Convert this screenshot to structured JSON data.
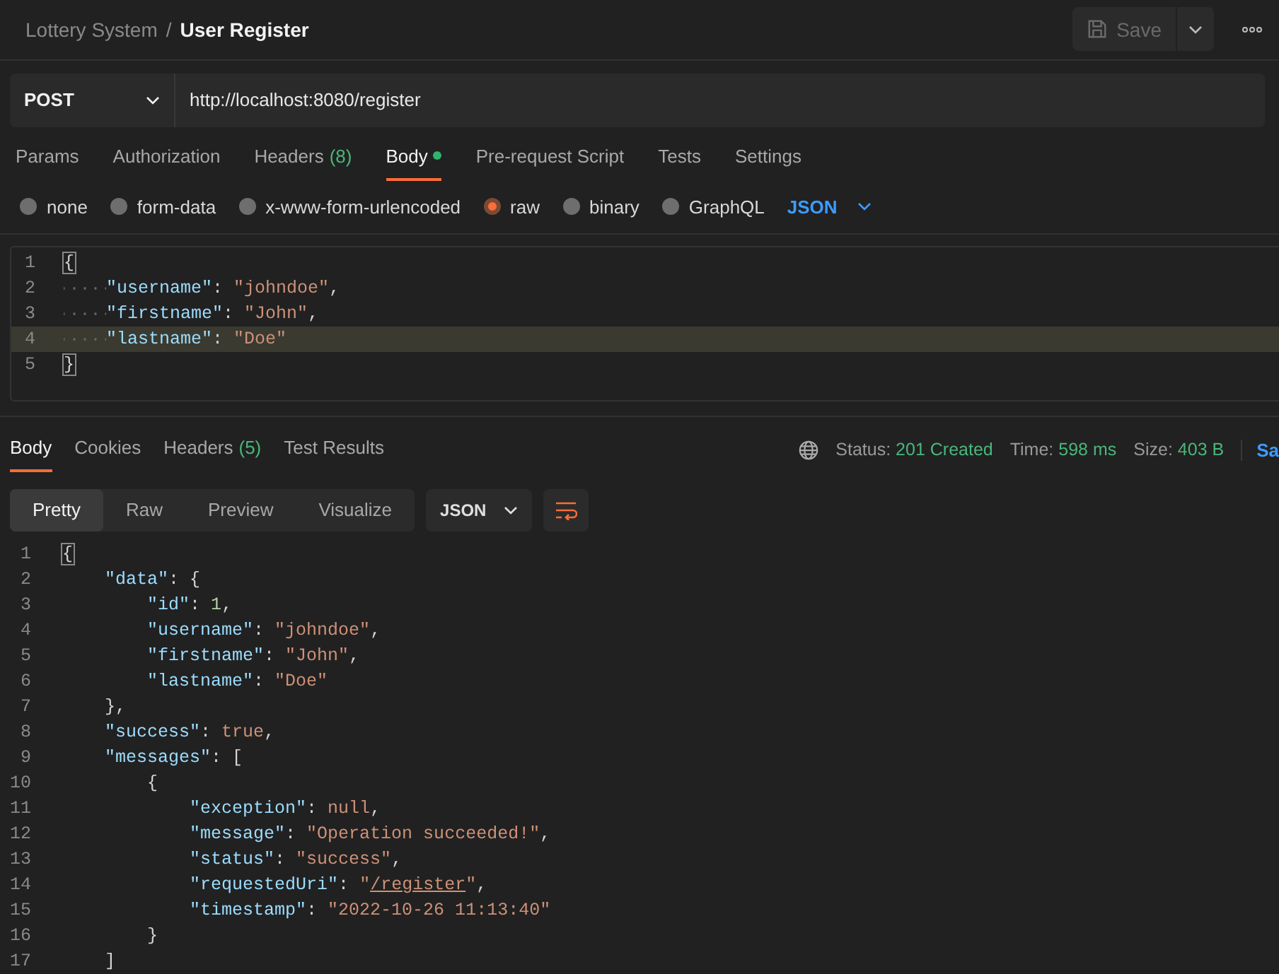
{
  "breadcrumb": {
    "parent": "Lottery System",
    "separator": "/",
    "current": "User Register"
  },
  "save_button": {
    "label": "Save",
    "disabled": true
  },
  "request": {
    "method": "POST",
    "url": "http://localhost:8080/register"
  },
  "request_tabs": [
    {
      "label": "Params",
      "dot": false,
      "selected": false
    },
    {
      "label": "Authorization",
      "dot": false,
      "selected": false
    },
    {
      "label": "Headers",
      "count": "(8)",
      "dot": false,
      "selected": false
    },
    {
      "label": "Body",
      "dot": true,
      "selected": true
    },
    {
      "label": "Pre-request Script",
      "dot": false,
      "selected": false
    },
    {
      "label": "Tests",
      "dot": false,
      "selected": false
    },
    {
      "label": "Settings",
      "dot": false,
      "selected": false
    }
  ],
  "body_types": [
    {
      "label": "none",
      "selected": false
    },
    {
      "label": "form-data",
      "selected": false
    },
    {
      "label": "x-www-form-urlencoded",
      "selected": false
    },
    {
      "label": "raw",
      "selected": true
    },
    {
      "label": "binary",
      "selected": false
    },
    {
      "label": "GraphQL",
      "selected": false
    }
  ],
  "body_format": "JSON",
  "request_body": [
    {
      "number": "1",
      "selected": false,
      "tokens": [
        {
          "kind": "match",
          "text": "{"
        }
      ]
    },
    {
      "number": "2",
      "selected": false,
      "tokens": [
        {
          "kind": "key",
          "text": "    \"username\""
        },
        {
          "kind": "punct",
          "text": ": "
        },
        {
          "kind": "string",
          "text": "\"johndoe\""
        },
        {
          "kind": "punct",
          "text": ","
        }
      ]
    },
    {
      "number": "3",
      "selected": false,
      "tokens": [
        {
          "kind": "key",
          "text": "    \"firstname\""
        },
        {
          "kind": "punct",
          "text": ": "
        },
        {
          "kind": "string",
          "text": "\"John\""
        },
        {
          "kind": "punct",
          "text": ","
        }
      ]
    },
    {
      "number": "4",
      "selected": true,
      "tokens": [
        {
          "kind": "key",
          "text": "    \"lastname\""
        },
        {
          "kind": "punct",
          "text": ": "
        },
        {
          "kind": "string",
          "text": "\"Doe\""
        }
      ]
    },
    {
      "number": "5",
      "selected": false,
      "tokens": [
        {
          "kind": "match",
          "text": "}"
        }
      ]
    }
  ],
  "response_tabs": [
    {
      "label": "Body",
      "selected": true
    },
    {
      "label": "Cookies",
      "selected": false
    },
    {
      "label": "Headers",
      "count": "(5)",
      "selected": false
    },
    {
      "label": "Test Results",
      "selected": false
    }
  ],
  "response_status": [
    {
      "label": "Status:",
      "value": "201 Created"
    },
    {
      "label": "Time:",
      "value": "598 ms"
    },
    {
      "label": "Size:",
      "value": "403 B"
    }
  ],
  "save_response": "Sa",
  "view_modes": [
    {
      "label": "Pretty",
      "selected": true
    },
    {
      "label": "Raw",
      "selected": false
    },
    {
      "label": "Preview",
      "selected": false
    },
    {
      "label": "Visualize",
      "selected": false
    }
  ],
  "response_format": "JSON",
  "response_body": [
    {
      "number": "1",
      "tokens": [
        {
          "kind": "match",
          "text": "{"
        }
      ]
    },
    {
      "number": "2",
      "tokens": [
        {
          "kind": "key",
          "text": "    \"data\""
        },
        {
          "kind": "punct",
          "text": ": {"
        }
      ]
    },
    {
      "number": "3",
      "tokens": [
        {
          "kind": "key",
          "text": "        \"id\""
        },
        {
          "kind": "punct",
          "text": ": "
        },
        {
          "kind": "number",
          "text": "1"
        },
        {
          "kind": "punct",
          "text": ","
        }
      ]
    },
    {
      "number": "4",
      "tokens": [
        {
          "kind": "key",
          "text": "        \"username\""
        },
        {
          "kind": "punct",
          "text": ": "
        },
        {
          "kind": "string",
          "text": "\"johndoe\""
        },
        {
          "kind": "punct",
          "text": ","
        }
      ]
    },
    {
      "number": "5",
      "tokens": [
        {
          "kind": "key",
          "text": "        \"firstname\""
        },
        {
          "kind": "punct",
          "text": ": "
        },
        {
          "kind": "string",
          "text": "\"John\""
        },
        {
          "kind": "punct",
          "text": ","
        }
      ]
    },
    {
      "number": "6",
      "tokens": [
        {
          "kind": "key",
          "text": "        \"lastname\""
        },
        {
          "kind": "punct",
          "text": ": "
        },
        {
          "kind": "string",
          "text": "\"Doe\""
        }
      ]
    },
    {
      "number": "7",
      "tokens": [
        {
          "kind": "punct",
          "text": "    },"
        }
      ]
    },
    {
      "number": "8",
      "tokens": [
        {
          "kind": "key",
          "text": "    \"success\""
        },
        {
          "kind": "punct",
          "text": ": "
        },
        {
          "kind": "literal",
          "text": "true"
        },
        {
          "kind": "punct",
          "text": ","
        }
      ]
    },
    {
      "number": "9",
      "tokens": [
        {
          "kind": "key",
          "text": "    \"messages\""
        },
        {
          "kind": "punct",
          "text": ": ["
        }
      ]
    },
    {
      "number": "10",
      "tokens": [
        {
          "kind": "punct",
          "text": "        {"
        }
      ]
    },
    {
      "number": "11",
      "tokens": [
        {
          "kind": "key",
          "text": "            \"exception\""
        },
        {
          "kind": "punct",
          "text": ": "
        },
        {
          "kind": "literal",
          "text": "null"
        },
        {
          "kind": "punct",
          "text": ","
        }
      ]
    },
    {
      "number": "12",
      "tokens": [
        {
          "kind": "key",
          "text": "            \"message\""
        },
        {
          "kind": "punct",
          "text": ": "
        },
        {
          "kind": "string",
          "text": "\"Operation succeeded!\""
        },
        {
          "kind": "punct",
          "text": ","
        }
      ]
    },
    {
      "number": "13",
      "tokens": [
        {
          "kind": "key",
          "text": "            \"status\""
        },
        {
          "kind": "punct",
          "text": ": "
        },
        {
          "kind": "string",
          "text": "\"success\""
        },
        {
          "kind": "punct",
          "text": ","
        }
      ]
    },
    {
      "number": "14",
      "tokens": [
        {
          "kind": "key",
          "text": "            \"requestedUri\""
        },
        {
          "kind": "punct",
          "text": ": "
        },
        {
          "kind": "string",
          "text": "\""
        },
        {
          "kind": "link",
          "text": "/register"
        },
        {
          "kind": "string",
          "text": "\""
        },
        {
          "kind": "punct",
          "text": ","
        }
      ]
    },
    {
      "number": "15",
      "tokens": [
        {
          "kind": "key",
          "text": "            \"timestamp\""
        },
        {
          "kind": "punct",
          "text": ": "
        },
        {
          "kind": "string",
          "text": "\"2022-10-26 11:13:40\""
        }
      ]
    },
    {
      "number": "16",
      "tokens": [
        {
          "kind": "punct",
          "text": "        }"
        }
      ]
    },
    {
      "number": "17",
      "tokens": [
        {
          "kind": "punct",
          "text": "    ]"
        }
      ]
    }
  ]
}
